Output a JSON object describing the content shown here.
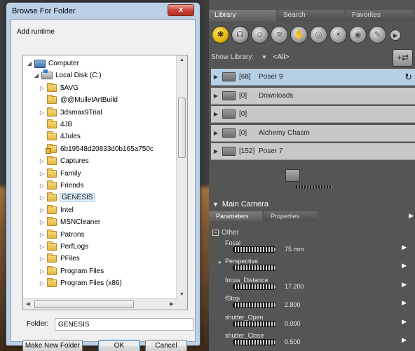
{
  "dialog": {
    "title": "Browse For Folder",
    "close_label": "x",
    "description": "Add runtime",
    "folder_label": "Folder:",
    "folder_value": "GENESIS",
    "buttons": {
      "make_new_folder": "Make New Folder",
      "ok": "OK",
      "cancel": "Cancel"
    },
    "tree": [
      {
        "label": "Computer",
        "level": 0,
        "icon": "computer-icon",
        "expander": "open"
      },
      {
        "label": "Local Disk (C:)",
        "level": 1,
        "icon": "disk-icon",
        "expander": "open"
      },
      {
        "label": "$AVG",
        "level": 2,
        "icon": "folder-icon",
        "expander": "closed"
      },
      {
        "label": "@@MulletArtBuild",
        "level": 2,
        "icon": "folder-icon",
        "expander": "none"
      },
      {
        "label": "3dsmax9Trial",
        "level": 2,
        "icon": "folder-icon",
        "expander": "closed"
      },
      {
        "label": "4JB",
        "level": 2,
        "icon": "folder-icon",
        "expander": "none"
      },
      {
        "label": "4Jules",
        "level": 2,
        "icon": "folder-icon",
        "expander": "none"
      },
      {
        "label": "6b19548d20833d0b165a750c",
        "level": 2,
        "icon": "locked-folder-icon",
        "expander": "none"
      },
      {
        "label": "Captures",
        "level": 2,
        "icon": "folder-icon",
        "expander": "closed"
      },
      {
        "label": "Family",
        "level": 2,
        "icon": "folder-icon",
        "expander": "closed"
      },
      {
        "label": "Friends",
        "level": 2,
        "icon": "folder-icon",
        "expander": "closed"
      },
      {
        "label": "GENESIS",
        "level": 2,
        "icon": "folder-icon",
        "expander": "closed",
        "selected": true
      },
      {
        "label": "Intel",
        "level": 2,
        "icon": "folder-icon",
        "expander": "closed"
      },
      {
        "label": "MSNCleaner",
        "level": 2,
        "icon": "folder-icon",
        "expander": "closed"
      },
      {
        "label": "Patrons",
        "level": 2,
        "icon": "folder-icon",
        "expander": "closed"
      },
      {
        "label": "PerfLogs",
        "level": 2,
        "icon": "folder-icon",
        "expander": "closed"
      },
      {
        "label": "PFiles",
        "level": 2,
        "icon": "folder-icon",
        "expander": "closed"
      },
      {
        "label": "Program Files",
        "level": 2,
        "icon": "folder-icon",
        "expander": "closed"
      },
      {
        "label": "Program Files (x86)",
        "level": 2,
        "icon": "folder-icon",
        "expander": "closed"
      }
    ]
  },
  "library": {
    "tabs": [
      "Library",
      "Search",
      "Favorites"
    ],
    "active_tab": "Library",
    "icons": [
      "figures-icon",
      "poses-icon",
      "faces-icon",
      "hair-icon",
      "hands-icon",
      "props-icon",
      "lights-icon",
      "cameras-icon",
      "materials-icon"
    ],
    "show_library_label": "Show Library:",
    "show_library_value": "<All>",
    "rows": [
      {
        "count": "[68]",
        "name": "Poser 9",
        "selected": true
      },
      {
        "count": "[0]",
        "name": "Downloads"
      },
      {
        "count": "[0]",
        "name": ""
      },
      {
        "count": "[0]",
        "name": "Alchemy Chasm"
      },
      {
        "count": "[152]",
        "name": "Poser 7"
      }
    ]
  },
  "camera": {
    "title": "Main Camera",
    "tabs": [
      "Parameters",
      "Properties"
    ],
    "group": "Other",
    "params": [
      {
        "label": "Focal",
        "value": "75 mm"
      },
      {
        "label": "Perspective",
        "value": ""
      },
      {
        "label": "focus_Distance",
        "value": "17.200"
      },
      {
        "label": "fStop",
        "value": "2.800"
      },
      {
        "label": "shutter_Open",
        "value": "0.000"
      },
      {
        "label": "shutter_Close",
        "value": "0.500"
      }
    ]
  }
}
